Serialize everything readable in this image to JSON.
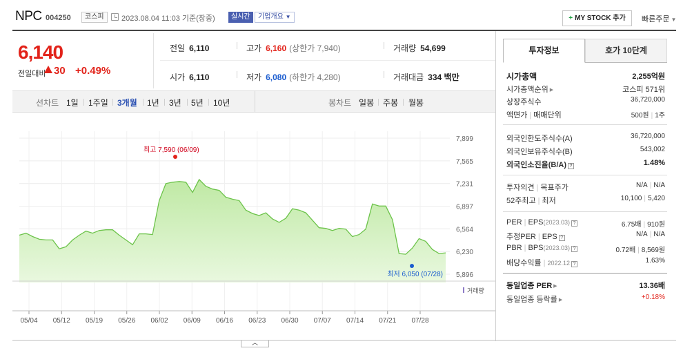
{
  "header": {
    "name": "NPC",
    "code": "004250",
    "market": "코스피",
    "time": "2023.08.04 11:03 기준(장중)",
    "realtime": "실시간",
    "overview": "기업개요",
    "mystock_plus": "+",
    "mystock": "MY STOCK 추가",
    "quick": "빠른주문"
  },
  "quote": {
    "price": "6,140",
    "change_label": "전일대비",
    "change": "30",
    "change_pct": "+0.49%",
    "prev_label": "전일",
    "prev": "6,110",
    "high_label": "고가",
    "high": "6,160",
    "upper_limit": "(상한가 7,940)",
    "volume_label": "거래량",
    "volume": "54,699",
    "open_label": "시가",
    "open": "6,110",
    "low_label": "저가",
    "low": "6,080",
    "lower_limit": "(하한가 4,280)",
    "amount_label": "거래대금",
    "amount": "334 백만"
  },
  "toolbar": {
    "line_label": "선차트",
    "ranges": [
      "1일",
      "1주일",
      "3개월",
      "1년",
      "3년",
      "5년",
      "10년"
    ],
    "active_range": "3개월",
    "candle_label": "봉차트",
    "candles": [
      "일봉",
      "주봉",
      "월봉"
    ]
  },
  "chart_data": {
    "type": "area",
    "y_ticks": [
      7899,
      7565,
      7231,
      6897,
      6564,
      6230,
      5896
    ],
    "y_tick_labels": [
      "7,899",
      "7,565",
      "7,231",
      "6,897",
      "6,564",
      "6,230",
      "5,896"
    ],
    "ylim": [
      5896,
      7899
    ],
    "x_tick_labels": [
      "05/04",
      "05/12",
      "05/19",
      "05/26",
      "06/02",
      "06/09",
      "06/16",
      "06/23",
      "06/30",
      "07/07",
      "07/14",
      "07/21",
      "07/28"
    ],
    "price": [
      6470,
      6500,
      6450,
      6410,
      6400,
      6400,
      6270,
      6300,
      6400,
      6470,
      6530,
      6500,
      6540,
      6550,
      6550,
      6470,
      6400,
      6330,
      6490,
      6490,
      6480,
      6980,
      7230,
      7250,
      7260,
      7250,
      7100,
      7290,
      7190,
      7150,
      7130,
      7030,
      7000,
      6980,
      6840,
      6790,
      6760,
      6800,
      6710,
      6660,
      6720,
      6860,
      6840,
      6800,
      6690,
      6580,
      6570,
      6540,
      6570,
      6560,
      6450,
      6480,
      6560,
      6930,
      6900,
      6900,
      6700,
      6200,
      6190,
      6280,
      6420,
      6380,
      6260,
      6200,
      6210
    ],
    "volume_label": "거래량",
    "volume": [
      0,
      0,
      0,
      0,
      0,
      0,
      0,
      0,
      0,
      0,
      0,
      0,
      0,
      0,
      0,
      0,
      0,
      0,
      0,
      0,
      0,
      0,
      0,
      0,
      0,
      0,
      0,
      0,
      0,
      0,
      0,
      0,
      0,
      0,
      0,
      0,
      0,
      0,
      0,
      0,
      0,
      0,
      0,
      0,
      0,
      0,
      0,
      0,
      0,
      0,
      0,
      0,
      0,
      0,
      0,
      0,
      0,
      0,
      0,
      0,
      0,
      0,
      0,
      0,
      0
    ],
    "max_annotation": "최고 7,590 (06/09)",
    "min_annotation": "최저 6,050 (07/28)"
  },
  "panel": {
    "tab_active": "투자정보",
    "tab_other": "호가 10단계",
    "market_cap_label": "시가총액",
    "market_cap": "2,255억원",
    "cap_rank_label": "시가총액순위",
    "cap_rank": "코스피 571위",
    "shares_label": "상장주식수",
    "shares": "36,720,000",
    "par_label": "액면가",
    "lot_label": "매매단위",
    "par": "500원",
    "lot": "1주",
    "foreign_limit_label": "외국인한도주식수(A)",
    "foreign_limit": "36,720,000",
    "foreign_hold_label": "외국인보유주식수(B)",
    "foreign_hold": "543,002",
    "foreign_ratio_label": "외국인소진율(B/A)",
    "foreign_ratio": "1.48%",
    "opinion_label": "투자의견",
    "target_label": "목표주가",
    "opinion": "N/A",
    "target": "N/A",
    "week52_label": "52주최고",
    "week52_low_label": "최저",
    "week52_high": "10,100",
    "week52_low": "5,420",
    "per_label": "PER",
    "eps_label": "EPS",
    "per_year": "(2023.03)",
    "per": "6.75배",
    "eps": "910원",
    "est_per_label": "추정PER",
    "est_eps_label": "EPS",
    "est_per": "N/A",
    "est_eps": "N/A",
    "pbr_label": "PBR",
    "bps_label": "BPS",
    "pbr_year": "(2023.03)",
    "pbr": "0.72배",
    "bps": "8,569원",
    "div_label": "배당수익률",
    "div_year": "2022.12",
    "div": "1.63%",
    "sector_per_label": "동일업종 PER",
    "sector_per": "13.36배",
    "sector_chg_label": "동일업종 등락률",
    "sector_chg": "+0.18%"
  }
}
